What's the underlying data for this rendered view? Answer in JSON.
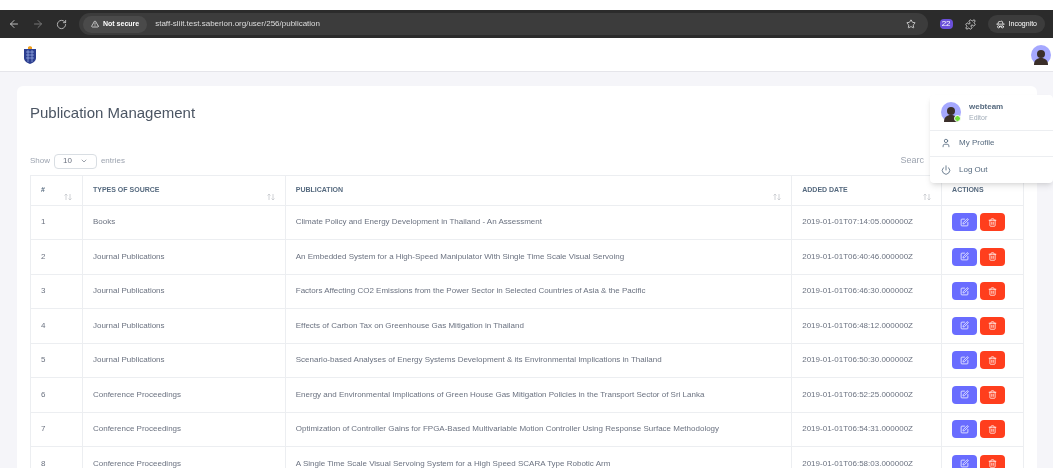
{
  "browser": {
    "security": "Not secure",
    "url": "staff-sliit.test.saberion.org/user/256/publication",
    "extension_badge": "22",
    "incognito": "Incognito"
  },
  "page": {
    "title": "Publication Management",
    "length": {
      "show": "Show",
      "value": "10",
      "entries": "entries"
    },
    "search_label": "Searc"
  },
  "table": {
    "columns": [
      {
        "label": "#",
        "sortable": true
      },
      {
        "label": "TYPES OF SOURCE",
        "sortable": true
      },
      {
        "label": "PUBLICATION",
        "sortable": true
      },
      {
        "label": "ADDED DATE",
        "sortable": true
      },
      {
        "label": "ACTIONS",
        "sortable": false
      }
    ],
    "rows": [
      {
        "n": "1",
        "type": "Books",
        "publication": "Climate Policy and Energy Development in Thailand - An Assessment",
        "date": "2019-01-01T07:14:05.000000Z"
      },
      {
        "n": "2",
        "type": "Journal Publications",
        "publication": "An Embedded System for a High-Speed Manipulator With Single Time Scale Visual Servoing",
        "date": "2019-01-01T06:40:46.000000Z"
      },
      {
        "n": "3",
        "type": "Journal Publications",
        "publication": "Factors Affecting CO2 Emissions from the Power Sector in Selected Countries of Asia & the Pacific",
        "date": "2019-01-01T06:46:30.000000Z"
      },
      {
        "n": "4",
        "type": "Journal Publications",
        "publication": "Effects of Carbon Tax on Greenhouse Gas Mitigation in Thailand",
        "date": "2019-01-01T06:48:12.000000Z"
      },
      {
        "n": "5",
        "type": "Journal Publications",
        "publication": "Scenario-based Analyses of Energy Systems Development & its Environmental Implications in Thailand",
        "date": "2019-01-01T06:50:30.000000Z"
      },
      {
        "n": "6",
        "type": "Conference Proceedings",
        "publication": "Energy and Environmental Implications of Green House Gas Mitigation Policies in the Transport Sector of Sri Lanka",
        "date": "2019-01-01T06:52:25.000000Z"
      },
      {
        "n": "7",
        "type": "Conference Proceedings",
        "publication": "Optimization of Controller Gains for FPGA-Based Multivariable Motion Controller Using Response Surface Methodology",
        "date": "2019-01-01T06:54:31.000000Z"
      },
      {
        "n": "8",
        "type": "Conference Proceedings",
        "publication": "A Single Time Scale Visual Servoing System for a High Speed SCARA Type Robotic Arm",
        "date": "2019-01-01T06:58:03.000000Z"
      }
    ]
  },
  "user_menu": {
    "name": "webteam",
    "role": "Editor",
    "online": true,
    "items": [
      {
        "kind": "profile",
        "label": "My Profile"
      },
      {
        "kind": "logout",
        "label": "Log Out"
      }
    ]
  }
}
